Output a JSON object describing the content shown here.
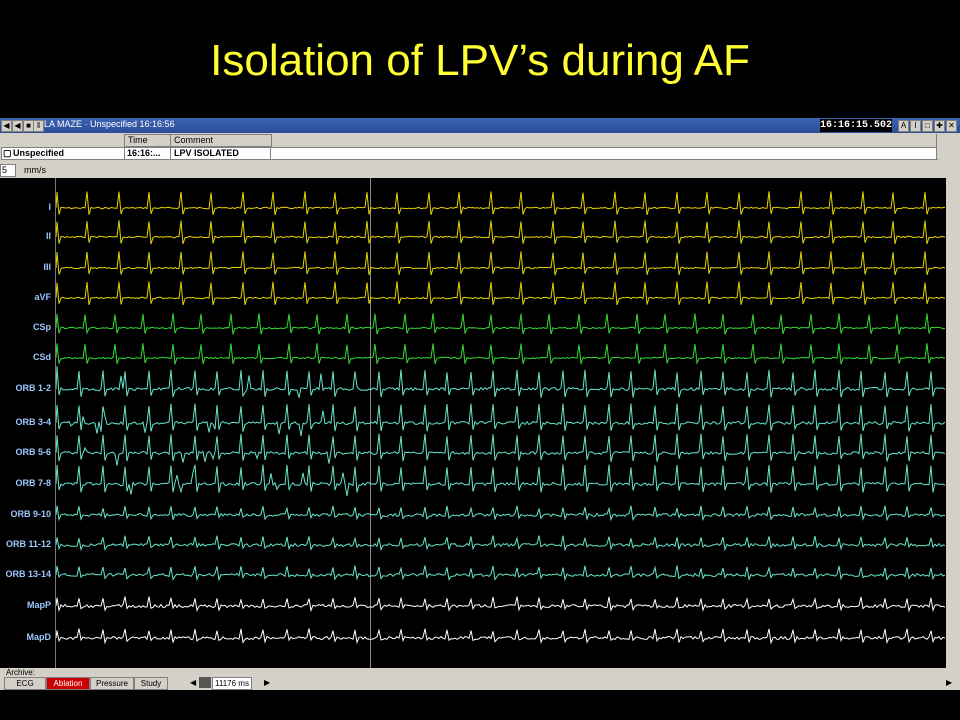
{
  "slide": {
    "title": "Isolation of LPV’s during AF"
  },
  "window": {
    "title": "LA MAZE · Unspecified  16:16:56",
    "clock": "16:16:15.502"
  },
  "info": {
    "patient": "Unspecified",
    "time_header": "Time",
    "comment_header": "Comment",
    "time_value": "16:16:...",
    "comment_value": "LPV ISOLATED"
  },
  "speed": {
    "value": "5",
    "unit": "mm/s"
  },
  "channels": [
    {
      "label": "I",
      "color": "#e8d400"
    },
    {
      "label": "II",
      "color": "#e8d400"
    },
    {
      "label": "III",
      "color": "#e8d400"
    },
    {
      "label": "aVF",
      "color": "#e8d400"
    },
    {
      "label": "CSp",
      "color": "#33dd33"
    },
    {
      "label": "CSd",
      "color": "#33dd33"
    },
    {
      "label": "ORB 1-2",
      "color": "#66e6cc"
    },
    {
      "label": "ORB 3-4",
      "color": "#66e6cc"
    },
    {
      "label": "ORB 5-6",
      "color": "#66e6cc"
    },
    {
      "label": "ORB 7-8",
      "color": "#66e6cc"
    },
    {
      "label": "ORB 9-10",
      "color": "#66e6cc"
    },
    {
      "label": "ORB 11-12",
      "color": "#66e6cc"
    },
    {
      "label": "ORB 13-14",
      "color": "#66e6cc"
    },
    {
      "label": "MapP",
      "color": "#ffffff"
    },
    {
      "label": "MapD",
      "color": "#ffffff"
    }
  ],
  "footer": {
    "archive_label": "Archive:",
    "tabs": [
      "ECG",
      "Ablation",
      "Pressure",
      "Study"
    ],
    "active_tab": "Ablation",
    "duration": "11176 ms"
  }
}
